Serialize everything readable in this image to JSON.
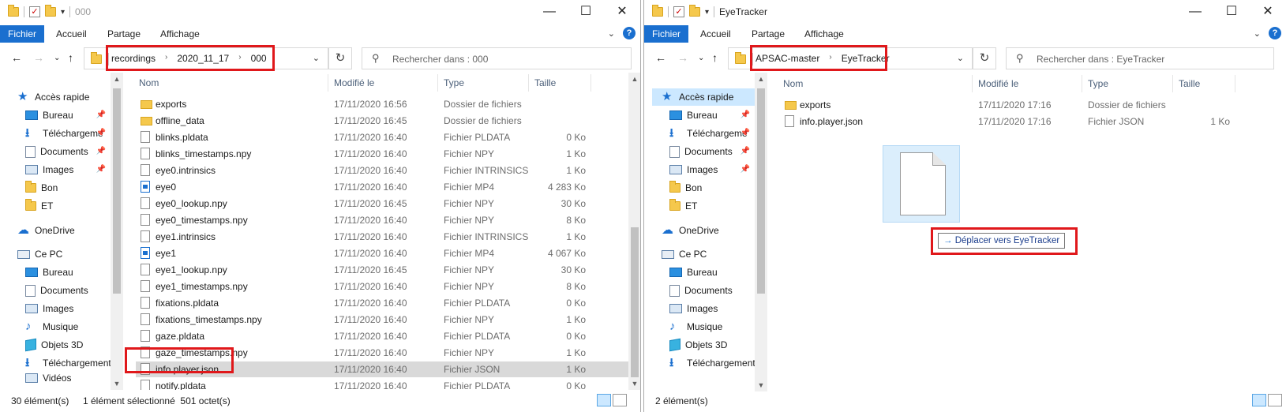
{
  "window1": {
    "title": "000",
    "ribbon_tabs": [
      "Fichier",
      "Accueil",
      "Partage",
      "Affichage"
    ],
    "address_crumbs": [
      "recordings",
      "2020_11_17",
      "000"
    ],
    "search_placeholder": "Rechercher dans : 000",
    "columns": {
      "name": "Nom",
      "modified": "Modifié le",
      "type": "Type",
      "size": "Taille"
    },
    "nav": {
      "quick_access": "Accès rapide",
      "quick_items": [
        "Bureau",
        "Téléchargeme",
        "Documents",
        "Images",
        "Bon",
        "ET"
      ],
      "onedrive": "OneDrive",
      "this_pc": "Ce PC",
      "pc_items": [
        "Bureau",
        "Documents",
        "Images",
        "Musique",
        "Objets 3D",
        "Téléchargements",
        "Vidéos"
      ]
    },
    "files": [
      {
        "name": "exports",
        "modified": "17/11/2020 16:56",
        "type": "Dossier de fichiers",
        "size": "",
        "icon": "folder"
      },
      {
        "name": "offline_data",
        "modified": "17/11/2020 16:45",
        "type": "Dossier de fichiers",
        "size": "",
        "icon": "folder"
      },
      {
        "name": "blinks.pldata",
        "modified": "17/11/2020 16:40",
        "type": "Fichier PLDATA",
        "size": "0 Ko",
        "icon": "file"
      },
      {
        "name": "blinks_timestamps.npy",
        "modified": "17/11/2020 16:40",
        "type": "Fichier NPY",
        "size": "1 Ko",
        "icon": "file"
      },
      {
        "name": "eye0.intrinsics",
        "modified": "17/11/2020 16:40",
        "type": "Fichier INTRINSICS",
        "size": "1 Ko",
        "icon": "file"
      },
      {
        "name": "eye0",
        "modified": "17/11/2020 16:40",
        "type": "Fichier MP4",
        "size": "4 283 Ko",
        "icon": "mp4"
      },
      {
        "name": "eye0_lookup.npy",
        "modified": "17/11/2020 16:45",
        "type": "Fichier NPY",
        "size": "30 Ko",
        "icon": "file"
      },
      {
        "name": "eye0_timestamps.npy",
        "modified": "17/11/2020 16:40",
        "type": "Fichier NPY",
        "size": "8 Ko",
        "icon": "file"
      },
      {
        "name": "eye1.intrinsics",
        "modified": "17/11/2020 16:40",
        "type": "Fichier INTRINSICS",
        "size": "1 Ko",
        "icon": "file"
      },
      {
        "name": "eye1",
        "modified": "17/11/2020 16:40",
        "type": "Fichier MP4",
        "size": "4 067 Ko",
        "icon": "mp4"
      },
      {
        "name": "eye1_lookup.npy",
        "modified": "17/11/2020 16:45",
        "type": "Fichier NPY",
        "size": "30 Ko",
        "icon": "file"
      },
      {
        "name": "eye1_timestamps.npy",
        "modified": "17/11/2020 16:40",
        "type": "Fichier NPY",
        "size": "8 Ko",
        "icon": "file"
      },
      {
        "name": "fixations.pldata",
        "modified": "17/11/2020 16:40",
        "type": "Fichier PLDATA",
        "size": "0 Ko",
        "icon": "file"
      },
      {
        "name": "fixations_timestamps.npy",
        "modified": "17/11/2020 16:40",
        "type": "Fichier NPY",
        "size": "1 Ko",
        "icon": "file"
      },
      {
        "name": "gaze.pldata",
        "modified": "17/11/2020 16:40",
        "type": "Fichier PLDATA",
        "size": "0 Ko",
        "icon": "file"
      },
      {
        "name": "gaze_timestamps.npy",
        "modified": "17/11/2020 16:40",
        "type": "Fichier NPY",
        "size": "1 Ko",
        "icon": "file"
      },
      {
        "name": "info.player.json",
        "modified": "17/11/2020 16:40",
        "type": "Fichier JSON",
        "size": "1 Ko",
        "icon": "file",
        "selected": true
      },
      {
        "name": "notify.pldata",
        "modified": "17/11/2020 16:40",
        "type": "Fichier PLDATA",
        "size": "0 Ko",
        "icon": "file"
      }
    ],
    "status": {
      "count": "30 élément(s)",
      "selection": "1 élément sélectionné  501 octet(s)"
    }
  },
  "window2": {
    "title": "EyeTracker",
    "ribbon_tabs": [
      "Fichier",
      "Accueil",
      "Partage",
      "Affichage"
    ],
    "address_crumbs": [
      "APSAC-master",
      "EyeTracker"
    ],
    "search_placeholder": "Rechercher dans : EyeTracker",
    "columns": {
      "name": "Nom",
      "modified": "Modifié le",
      "type": "Type",
      "size": "Taille"
    },
    "nav": {
      "quick_access": "Accès rapide",
      "quick_items": [
        "Bureau",
        "Téléchargeme",
        "Documents",
        "Images",
        "Bon",
        "ET"
      ],
      "onedrive": "OneDrive",
      "this_pc": "Ce PC",
      "pc_items": [
        "Bureau",
        "Documents",
        "Images",
        "Musique",
        "Objets 3D",
        "Téléchargements"
      ]
    },
    "files": [
      {
        "name": "exports",
        "modified": "17/11/2020 17:16",
        "type": "Dossier de fichiers",
        "size": "",
        "icon": "folder"
      },
      {
        "name": "info.player.json",
        "modified": "17/11/2020 17:16",
        "type": "Fichier JSON",
        "size": "1 Ko",
        "icon": "file"
      }
    ],
    "status": {
      "count": "2 élément(s)"
    }
  },
  "drag": {
    "tooltip": "Déplacer vers EyeTracker"
  },
  "colors": {
    "accent": "#1a6fcf",
    "highlight_box": "#e0181b",
    "selected_row": "#d9d9d9",
    "nav_selected": "#cce8ff"
  }
}
